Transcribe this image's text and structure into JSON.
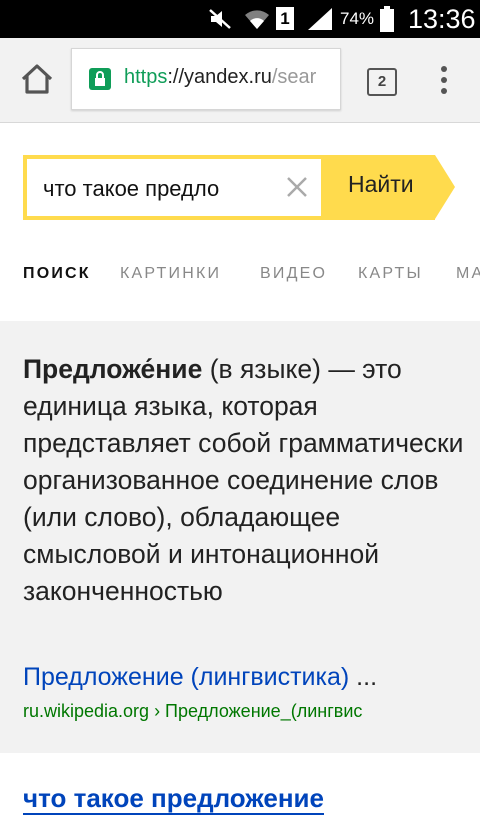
{
  "status_bar": {
    "battery_percent": "74%",
    "time": "13:36",
    "sim_slot": "1",
    "icons": [
      "mute-icon",
      "wifi-icon",
      "sim-icon",
      "signal-icon",
      "battery-icon"
    ]
  },
  "toolbar": {
    "url_scheme": "https",
    "url_sep": "://",
    "url_host": "yandex.ru",
    "url_tail": "/sear",
    "tab_count": "2"
  },
  "search": {
    "query": "что такое предло",
    "submit_label": "Найти"
  },
  "nav_tabs": [
    "ПОИСК",
    "КАРТИНКИ",
    "ВИДЕО",
    "КАРТЫ",
    "МА"
  ],
  "fact": {
    "term": "Предложе́ние",
    "definition": " (в языке) — это единица языка, которая представляет собой грамматически организованное соединение слов (или слово), обладающее смысловой и интонационной законченностью",
    "link_title": "Предложение (лингвистика)",
    "link_ellipsis": " ...",
    "source": "ru.wikipedia.org › Предложение_(лингвис"
  },
  "next_result": {
    "title": "что такое предложение"
  },
  "colors": {
    "accent_yellow": "#ffdb4d",
    "link_blue": "#0044bb",
    "source_green": "#007700",
    "secure_green": "#0f9d58"
  }
}
